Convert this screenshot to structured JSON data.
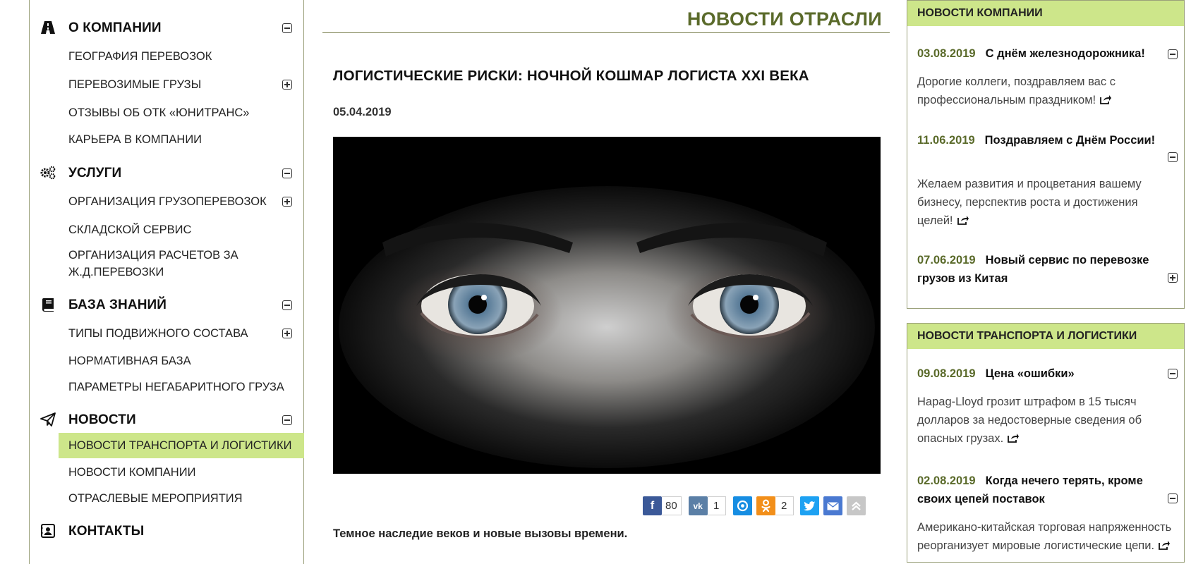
{
  "sidebar": {
    "sections": [
      {
        "title": "О КОМПАНИИ",
        "icon": "road-icon",
        "items": [
          {
            "label": "ГЕОГРАФИЯ ПЕРЕВОЗОК",
            "expandable": false
          },
          {
            "label": "ПЕРЕВОЗИМЫЕ ГРУЗЫ",
            "expandable": true
          },
          {
            "label": "ОТЗЫВЫ ОБ ОТК «ЮНИТРАНС»",
            "expandable": false
          },
          {
            "label": "КАРЬЕРА В КОМПАНИИ",
            "expandable": false
          }
        ]
      },
      {
        "title": "УСЛУГИ",
        "icon": "gears-icon",
        "items": [
          {
            "label": "ОРГАНИЗАЦИЯ ГРУЗОПЕРЕВОЗОК",
            "expandable": true
          },
          {
            "label": "СКЛАДСКОЙ СЕРВИС",
            "expandable": false
          },
          {
            "label": "ОРГАНИЗАЦИЯ РАСЧЕТОВ ЗА",
            "expandable": false
          },
          {
            "label": "Ж.Д.ПЕРЕВОЗКИ",
            "expandable": false
          }
        ]
      },
      {
        "title": "БАЗА ЗНАНИЙ",
        "icon": "book-icon",
        "items": [
          {
            "label": "ТИПЫ ПОДВИЖНОГО СОСТАВА",
            "expandable": true
          },
          {
            "label": "НОРМАТИВНАЯ БАЗА",
            "expandable": false
          },
          {
            "label": "ПАРАМЕТРЫ НЕГАБАРИТНОГО ГРУЗА",
            "expandable": false
          }
        ]
      },
      {
        "title": "НОВОСТИ",
        "icon": "paper-plane-icon",
        "items": [
          {
            "label": "НОВОСТИ ТРАНСПОРТА И ЛОГИСТИКИ",
            "active": true
          },
          {
            "label": "НОВОСТИ КОМПАНИИ"
          },
          {
            "label": "ОТРАСЛЕВЫЕ МЕРОПРИЯТИЯ"
          }
        ]
      },
      {
        "title": "КОНТАКТЫ",
        "icon": "contact-card-icon",
        "items": []
      }
    ],
    "active_color": "#cde68a"
  },
  "main": {
    "page_title": "НОВОСТИ ОТРАСЛИ",
    "article_title": "ЛОГИСТИЧЕСКИЕ РИСКИ: НОЧНОЙ КОШМАР ЛОГИСТА XXI ВЕКА",
    "article_date": "05.04.2019",
    "lead": "Темное наследие веков и новые вызовы времени.",
    "share": {
      "facebook_count": "80",
      "vk_count": "1",
      "odnoklassniki_count": "2"
    }
  },
  "widgets": {
    "company": {
      "title": "НОВОСТИ КОМПАНИИ",
      "items": [
        {
          "date": "03.08.2019",
          "headline": "С днём железнодорожника!",
          "body": "Дорогие коллеги, поздравляем вас с профессиональным праздником!"
        },
        {
          "date": "11.06.2019",
          "headline": "Поздравляем с Днём России!",
          "body": "Желаем развития и процветания вашему бизнесу, перспектив роста и достижения целей!"
        },
        {
          "date": "07.06.2019",
          "headline": "Новый сервис по перевозке грузов из Китая",
          "body": ""
        }
      ]
    },
    "transport": {
      "title": "НОВОСТИ ТРАНСПОРТА И ЛОГИСТИКИ",
      "items": [
        {
          "date": "09.08.2019",
          "headline": "Цена «ошибки»",
          "body": "Hapag-Lloyd грозит штрафом в 15 тысяч долларов за недостоверные сведения об опасных грузах."
        },
        {
          "date": "02.08.2019",
          "headline": "Когда нечего терять, кроме своих цепей поставок",
          "body": "Американо-китайская торговая напряженность реорганизует мировые логистические цепи."
        }
      ]
    }
  },
  "colors": {
    "accent_green": "#cde68a",
    "title_olive": "#5a6a2a",
    "border": "#9aa07a"
  }
}
